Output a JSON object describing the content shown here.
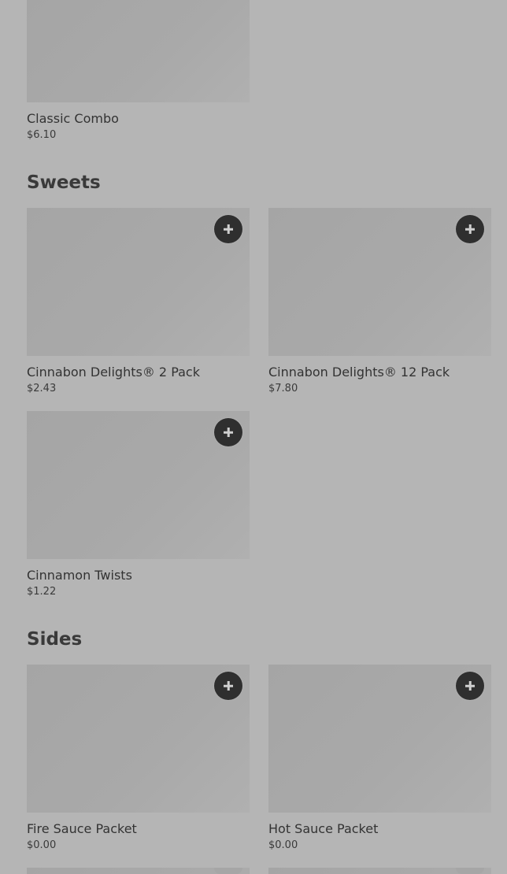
{
  "combos": {
    "items": [
      {
        "name": "Classic Combo",
        "price": "$6.10"
      }
    ]
  },
  "sweets": {
    "heading": "Sweets",
    "items": [
      {
        "name": "Cinnabon Delights® 2 Pack",
        "price": "$2.43"
      },
      {
        "name": "Cinnabon Delights® 12 Pack",
        "price": "$7.80"
      },
      {
        "name": "Cinnamon Twists",
        "price": "$1.22"
      }
    ]
  },
  "sides": {
    "heading": "Sides",
    "items": [
      {
        "name": "Fire Sauce Packet",
        "price": "$0.00"
      },
      {
        "name": "Hot Sauce Packet",
        "price": "$0.00"
      }
    ]
  },
  "icons": {
    "add": "plus-icon"
  },
  "colors": {
    "background": "#b5b5b5",
    "image_placeholder": "#a8a8a8",
    "add_button": "#2f2f2f",
    "text": "#333333"
  }
}
